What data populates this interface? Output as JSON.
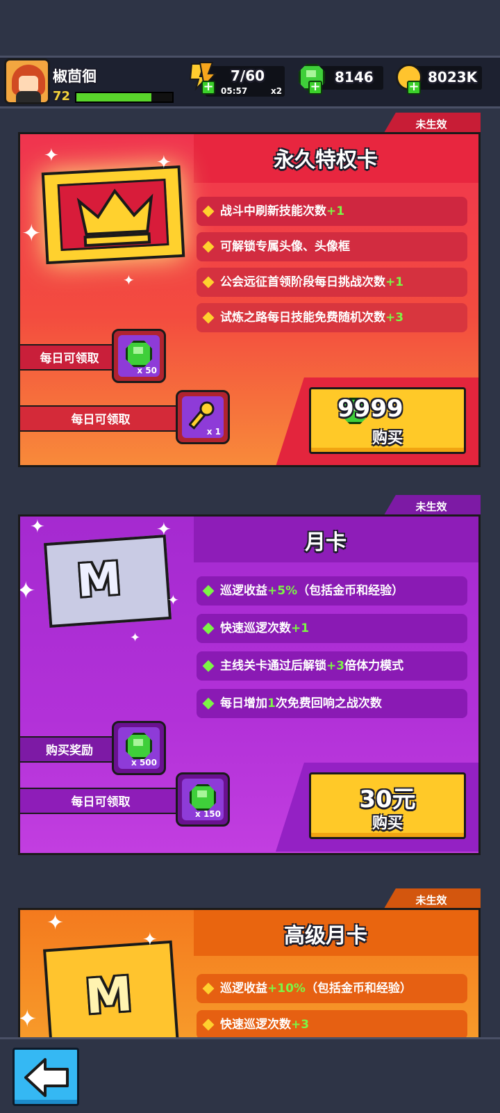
{
  "header": {
    "player_name": "椒茴徊",
    "level": "72",
    "xp_fraction": 0.78,
    "stamina": {
      "value": "7/60",
      "timer": "05:57",
      "multiplier": "x2"
    },
    "gems": "8146",
    "gold": "8023K"
  },
  "cards": [
    {
      "title": "永久特权卡",
      "status": "未生效",
      "benefits": [
        {
          "text": "战斗中刷新技能次数",
          "highlight": "+1"
        },
        {
          "text": "可解锁专属头像、头像框",
          "highlight": ""
        },
        {
          "text": "公会远征首领阶段每日挑战次数",
          "highlight": "+1"
        },
        {
          "text": "试炼之路每日技能免费随机次数",
          "highlight": "+3"
        }
      ],
      "rewards": [
        {
          "label": "每日可领取",
          "item": "gem",
          "qty": "x 50"
        },
        {
          "label": "每日可领取",
          "item": "key",
          "qty": "x 1"
        }
      ],
      "price": "9999",
      "buy_label": "购买"
    },
    {
      "title": "月卡",
      "status": "未生效",
      "benefits": [
        {
          "pre": "巡逻收益",
          "highlight": "+5%",
          "post": "（包括金币和经验）"
        },
        {
          "pre": "快速巡逻次数",
          "highlight": "+1",
          "post": ""
        },
        {
          "pre": "主线关卡通过后解锁",
          "highlight": "+3",
          "post": "倍体力模式"
        },
        {
          "pre": "每日增加",
          "highlight": "1",
          "post": "次免费回响之战次数"
        }
      ],
      "rewards": [
        {
          "label": "购买奖励",
          "item": "gem",
          "qty": "x 500"
        },
        {
          "label": "每日可领取",
          "item": "gem",
          "qty": "x 150"
        }
      ],
      "price": "30元",
      "buy_label": "购买"
    },
    {
      "title": "高级月卡",
      "status": "未生效",
      "benefits": [
        {
          "pre": "巡逻收益",
          "highlight": "+10%",
          "post": "（包括金币和经验）"
        },
        {
          "pre": "快速巡逻次数",
          "highlight": "+3",
          "post": ""
        }
      ]
    }
  ],
  "colors": {
    "card1": "#f0344f",
    "card2": "#a52ad0",
    "card3": "#f47a1e",
    "buy_button": "#ffc928",
    "highlight_green": "#7cf545"
  },
  "icons": [
    "crown-icon",
    "m-card-icon",
    "gem-icon",
    "key-icon",
    "back-arrow-icon",
    "stamina-icon",
    "gold-coin-icon"
  ]
}
